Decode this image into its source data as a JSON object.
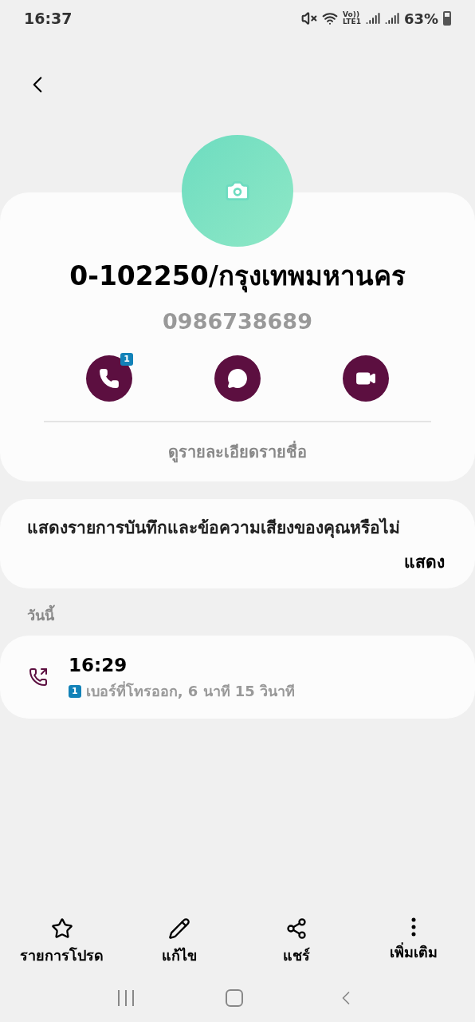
{
  "status_bar": {
    "time": "16:37",
    "network_labels": [
      "Vo))",
      "LTE1"
    ],
    "battery": "63%"
  },
  "contact": {
    "name": "0-102250/กรุงเทพมหานคร",
    "number": "0986738689",
    "call_badge": "1",
    "details_link": "ดูรายละเอียดรายชื่อ"
  },
  "actions": [
    {
      "kind": "call"
    },
    {
      "kind": "message"
    },
    {
      "kind": "video"
    }
  ],
  "recordings_prompt": {
    "text": "แสดงรายการบันทึกและข้อความเสียงของคุณหรือไม่",
    "button": "แสดง"
  },
  "history": {
    "heading": "วันนี้",
    "calls": [
      {
        "time": "16:29",
        "sim": "1",
        "detail": "เบอร์ที่โทรออก, 6 นาที 15 วินาที"
      }
    ]
  },
  "bottom_bar": [
    {
      "kind": "favorite",
      "label": "รายการโปรด"
    },
    {
      "kind": "edit",
      "label": "แก้ไข"
    },
    {
      "kind": "share",
      "label": "แชร์"
    },
    {
      "kind": "more",
      "label": "เพิ่มเติม"
    }
  ]
}
